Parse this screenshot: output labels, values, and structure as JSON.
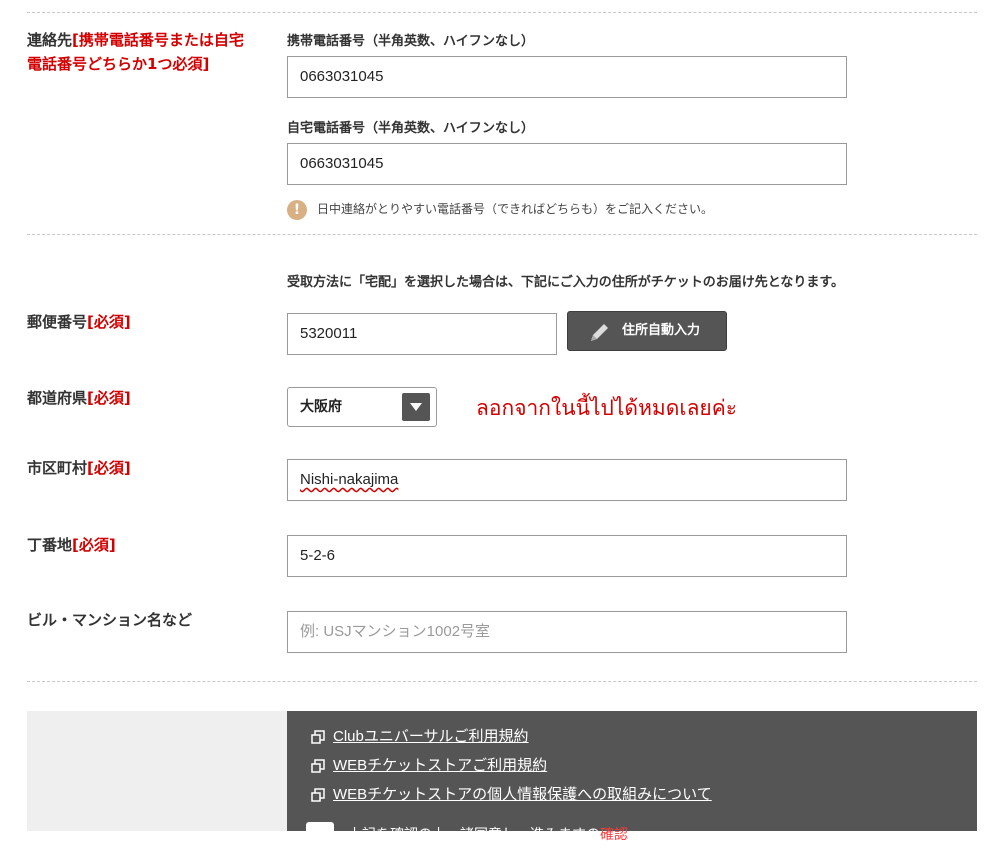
{
  "contact": {
    "label": "連絡先",
    "label_note": "[携帯電話番号または自宅電話番号どちらか1つ必須]",
    "mobile": {
      "label": "携帯電話番号（半角英数、ハイフンなし）",
      "value": "0663031045"
    },
    "home": {
      "label": "自宅電話番号（半角英数、ハイフンなし）",
      "value": "0663031045"
    },
    "note": "日中連絡がとりやすい電話番号（できればどちらも）をご記入ください。",
    "note_icon": "!"
  },
  "address": {
    "notice": "受取方法に「宅配」を選択した場合は、下記にご入力の住所がチケットのお届け先となります。",
    "postal": {
      "label": "郵便番号",
      "required": "[必須]",
      "value": "5320011",
      "auto_button": "住所自動入力"
    },
    "prefecture": {
      "label": "都道府県",
      "required": "[必須]",
      "selected": "大阪府"
    },
    "city": {
      "label": "市区町村",
      "required": "[必須]",
      "value": "Nishi-nakajima"
    },
    "street": {
      "label": "丁番地",
      "required": "[必須]",
      "value": "5-2-6"
    },
    "building": {
      "label": "ビル・マンション名など",
      "placeholder": "例: USJマンション1002号室"
    }
  },
  "annotation": "ลอกจากในนี้ไปได้หมดเลยค่ะ",
  "links": [
    "Clubユニバーサルご利用規約",
    "WEBチケットストアご利用規約",
    "WEBチケットストアの個人情報保護への取組みについて"
  ],
  "agree": {
    "text": "上記を確認の上、諸同意し、進みますの",
    "highlight": "確認"
  },
  "colors": {
    "required": "#d40000",
    "panel_dark": "#555555",
    "panel_light": "#efefef"
  }
}
